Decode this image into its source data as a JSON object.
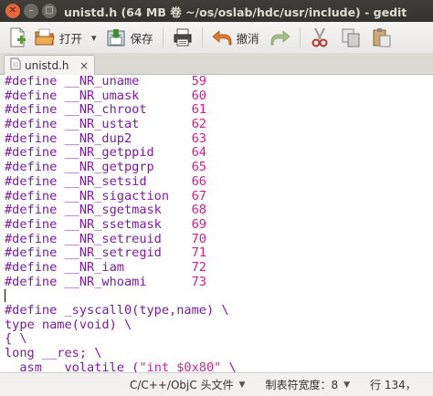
{
  "window": {
    "title": "unistd.h (64 MB 卷 ~/os/oslab/hdc/usr/include) - gedit",
    "close_glyph": "✕",
    "min_glyph": "–",
    "max_glyph": "□"
  },
  "toolbar": {
    "open_label": "打开",
    "save_label": "保存",
    "undo_label": "撤消",
    "open_dropdown": "▾"
  },
  "tab": {
    "label": "unistd.h",
    "close_glyph": "×"
  },
  "editor": {
    "lines": [
      {
        "a": "#define __NR_uname",
        "pad": "       ",
        "n": "59"
      },
      {
        "a": "#define __NR_umask",
        "pad": "       ",
        "n": "60"
      },
      {
        "a": "#define __NR_chroot",
        "pad": "      ",
        "n": "61"
      },
      {
        "a": "#define __NR_ustat",
        "pad": "       ",
        "n": "62"
      },
      {
        "a": "#define __NR_dup2",
        "pad": "        ",
        "n": "63"
      },
      {
        "a": "#define __NR_getppid",
        "pad": "     ",
        "n": "64"
      },
      {
        "a": "#define __NR_getpgrp",
        "pad": "     ",
        "n": "65"
      },
      {
        "a": "#define __NR_setsid",
        "pad": "      ",
        "n": "66"
      },
      {
        "a": "#define __NR_sigaction",
        "pad": "   ",
        "n": "67"
      },
      {
        "a": "#define __NR_sgetmask",
        "pad": "    ",
        "n": "68"
      },
      {
        "a": "#define __NR_ssetmask",
        "pad": "    ",
        "n": "69"
      },
      {
        "a": "#define __NR_setreuid",
        "pad": "    ",
        "n": "70"
      },
      {
        "a": "#define __NR_setregid",
        "pad": "    ",
        "n": "71"
      },
      {
        "a": "#define __NR_iam",
        "pad": "         ",
        "n": "72"
      },
      {
        "a": "#define __NR_whoami",
        "pad": "      ",
        "n": "73"
      }
    ],
    "macro_line": "#define _syscall0(type,name) \\",
    "type_line": "type name(void) \\",
    "brace_line": "{ \\",
    "long_line": "long __res; \\",
    "asm_kw": "__asm__",
    "asm_rest": " volatile (",
    "asm_str": "\"int $0x80\"",
    "asm_tail": " \\"
  },
  "statusbar": {
    "language": "C/C++/ObjC 头文件",
    "tab_width": "制表符宽度：8",
    "position": "行 134，"
  },
  "colors": {
    "keyword": "#7a1aa6",
    "number": "#e0158d",
    "titlebar": "#3c3b37"
  }
}
